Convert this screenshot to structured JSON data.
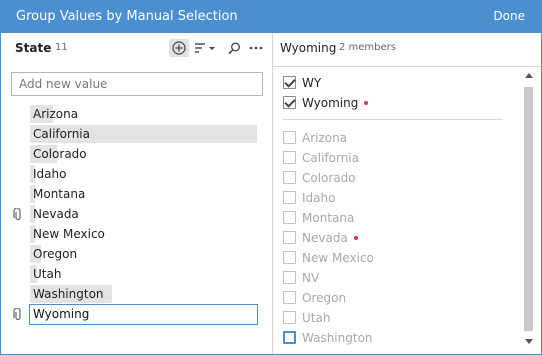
{
  "dialog": {
    "title": "Group Values by Manual Selection",
    "done_label": "Done"
  },
  "left_panel": {
    "field_name": "State",
    "value_count": "11",
    "add_placeholder": "Add new value",
    "toolbar_icons": [
      "add-group-icon",
      "sort-icon",
      "search-icon",
      "more-icon"
    ],
    "values": [
      {
        "label": "Arizona",
        "share": 0.1,
        "grouped": false,
        "active": false
      },
      {
        "label": "California",
        "share": 1.0,
        "grouped": false,
        "active": false
      },
      {
        "label": "Colorado",
        "share": 0.12,
        "grouped": false,
        "active": false
      },
      {
        "label": "Idaho",
        "share": 0.02,
        "grouped": false,
        "active": false
      },
      {
        "label": "Montana",
        "share": 0.02,
        "grouped": false,
        "active": false
      },
      {
        "label": "Nevada",
        "share": 0.02,
        "grouped": true,
        "active": false
      },
      {
        "label": "New Mexico",
        "share": 0.02,
        "grouped": false,
        "active": false
      },
      {
        "label": "Oregon",
        "share": 0.05,
        "grouped": false,
        "active": false
      },
      {
        "label": "Utah",
        "share": 0.03,
        "grouped": false,
        "active": false
      },
      {
        "label": "Washington",
        "share": 0.36,
        "grouped": false,
        "active": false
      },
      {
        "label": "Wyoming",
        "share": 0.0,
        "grouped": true,
        "active": true
      }
    ]
  },
  "right_panel": {
    "group_name": "Wyoming",
    "member_count": "2 members",
    "members": [
      {
        "label": "WY",
        "checked": true,
        "changed": false
      },
      {
        "label": "Wyoming",
        "checked": true,
        "changed": true
      }
    ],
    "others": [
      {
        "label": "Arizona",
        "checked": false,
        "changed": false
      },
      {
        "label": "California",
        "checked": false,
        "changed": false
      },
      {
        "label": "Colorado",
        "checked": false,
        "changed": false
      },
      {
        "label": "Idaho",
        "checked": false,
        "changed": false
      },
      {
        "label": "Montana",
        "checked": false,
        "changed": false
      },
      {
        "label": "Nevada",
        "checked": false,
        "changed": true
      },
      {
        "label": "New Mexico",
        "checked": false,
        "changed": false
      },
      {
        "label": "NV",
        "checked": false,
        "changed": false
      },
      {
        "label": "Oregon",
        "checked": false,
        "changed": false
      },
      {
        "label": "Utah",
        "checked": false,
        "changed": false
      },
      {
        "label": "Washington",
        "checked": false,
        "changed": false,
        "focused": true
      }
    ]
  },
  "colors": {
    "header": "#4a8fd0",
    "bar": "#e3e3e3",
    "changed_dot": "#e0333a"
  }
}
